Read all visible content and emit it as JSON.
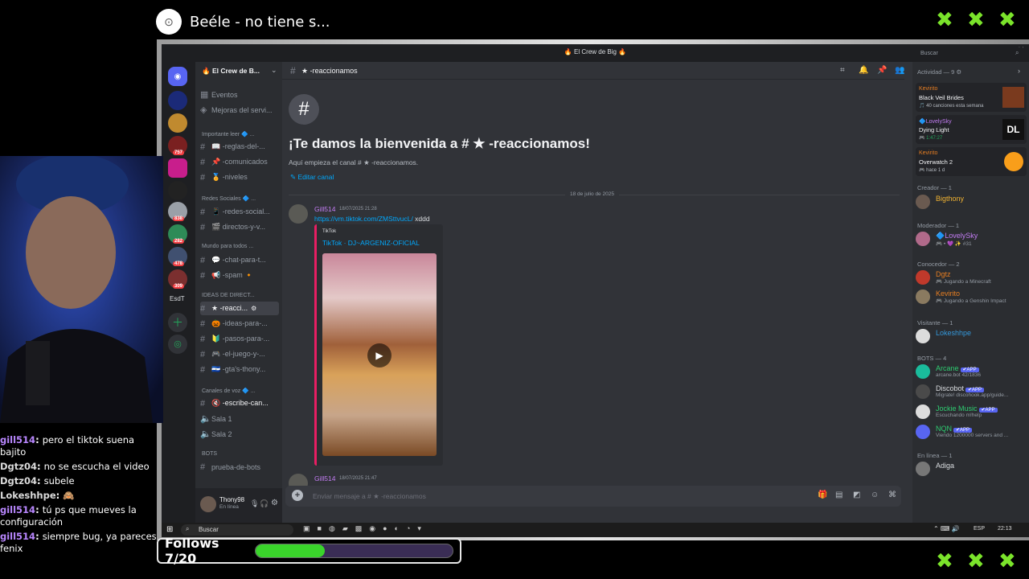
{
  "overlay": {
    "now_playing": "Beéle - no tiene s...",
    "x_marks": [
      "✖",
      "✖",
      "✖"
    ],
    "follows_label": "Follows 7/20",
    "follows_progress": 0.35,
    "accent_color": "#3ad42b"
  },
  "discord": {
    "window_title": "🔥 El Crew de Big 🔥",
    "server_name": "🔥 El Crew de B...",
    "channel_header": "★ -reaccionamos",
    "search_placeholder": "Buscar",
    "top_items": [
      "Eventos",
      "Mejoras del servi..."
    ],
    "categories": {
      "importante": "Importante leer 🔷 ...",
      "redes": "Redes Sociales 🔷 ...",
      "mundo": "Mundo para todos ...",
      "ideas": "IDEAS DE DIRECT...",
      "voz": "Canales de voz 🔷 ...",
      "bots": "BOTS"
    },
    "channels": {
      "reglas": "📖 -reglas-del-...",
      "comunicados": "📌 -comunicados",
      "niveles": "🏅 -niveles",
      "redes_social": "📱 -redes-social...",
      "directos": "🎬 directos-y-v...",
      "chat_para": "💬 -chat-para-t...",
      "spam": "📢 -spam 🔸",
      "reaccionamos": "★ -reacci...",
      "ideas_para": "🎃 -ideas-para-...",
      "pasos_para": "🔰 -pasos-para-...",
      "el_juego": "🎮 -el-juego-y-...",
      "gtas": "🇸🇻 -gta's-thony...",
      "escribe": "🔇 -escribe-can...",
      "sala1": "Sala 1",
      "sala2": "Sala 2",
      "prueba": "prueba-de-bots"
    },
    "server_badges": [
      "757",
      "838",
      "282",
      "478",
      "309"
    ],
    "server_label_esdt": "EsdT",
    "welcome_title": "¡Te damos la bienvenida a # ★ -reaccionamos!",
    "welcome_sub": "Aquí empieza el canal # ★ -reaccionamos.",
    "edit_channel": "Editar canal",
    "date_divider": "18 de julio de 2025",
    "msg1": {
      "author": "Gill514",
      "time": "18/07/2025 21:28",
      "link": "https://vm.tiktok.com/ZMSttvucL/",
      "text": " xddd",
      "embed_provider": "TikTok",
      "embed_title": "TikTok · DJ~ARGENIZ-OFICIAL"
    },
    "msg2": {
      "author": "Gill514",
      "time": "18/07/2025 21:47"
    },
    "composer_placeholder": "Enviar mensaje a # ★ -reaccionamos",
    "user": {
      "name": "Thony98",
      "status": "En línea"
    },
    "members": {
      "activity_header": "Actividad — 9 ⚙",
      "activities": [
        {
          "user": "Kevirito",
          "title": "Black Veil Brides",
          "sub": "🎵 40 canciones esta semana"
        },
        {
          "user": "🔷LovelySky",
          "title": "Dying Light",
          "sub": "🎮 1:47:27"
        },
        {
          "user": "Kevirito",
          "title": "Overwatch 2",
          "sub": "🎮 hace 1 d"
        }
      ],
      "groups": [
        {
          "label": "Creador — 1",
          "members": [
            {
              "name": "Bigthony",
              "sub": "",
              "color": "#f0b232"
            }
          ]
        },
        {
          "label": "Moderador — 1",
          "members": [
            {
              "name": "🔷LovelySky",
              "sub": "🎮 • 💜 ✨ #31",
              "color": "#c27cf2"
            }
          ]
        },
        {
          "label": "Conocedor — 2",
          "members": [
            {
              "name": "Dgtz",
              "sub": "🎮 Jugando a Minecraft",
              "color": "#e67e22"
            },
            {
              "name": "Kevirito",
              "sub": "🎮 Jugando a Genshin Impact",
              "color": "#e67e22"
            }
          ]
        },
        {
          "label": "Visitante — 1",
          "members": [
            {
              "name": "Lokeshhpe",
              "sub": "",
              "color": "#3498db"
            }
          ]
        },
        {
          "label": "BOTS — 4",
          "members": [
            {
              "name": "Arcane",
              "sub": "arcane.bot 42/1836",
              "color": "#2ecc71",
              "app": "✔APP"
            },
            {
              "name": "Discobot",
              "sub": "Migrate! discohook.app/guide...",
              "color": "#dbdee1",
              "app": "✔APP"
            },
            {
              "name": "Jockie Music",
              "sub": "Escuchando m!help",
              "color": "#2ecc71",
              "app": "✔APP"
            },
            {
              "name": "NQN",
              "sub": "Viendo 1200000 servers and ...",
              "color": "#2ecc71",
              "app": "✔APP"
            }
          ]
        },
        {
          "label": "En línea — 1",
          "members": [
            {
              "name": "Adiga",
              "sub": "",
              "color": "#dbdee1"
            }
          ]
        }
      ]
    }
  },
  "taskbar": {
    "search": "Buscar",
    "lang": "ESP",
    "clock": "22:13"
  },
  "twitch_chat": [
    {
      "user": "gill514",
      "color": "#b987ff",
      "text": "pero el tiktok suena bajito"
    },
    {
      "user": "Dgtz04",
      "color": "#dbdbdb",
      "text": "no se escucha el video"
    },
    {
      "user": "Dgtz04",
      "color": "#dbdbdb",
      "text": "subele"
    },
    {
      "user": "Lokeshhpe",
      "color": "#dbdbdb",
      "text": "🙈"
    },
    {
      "user": "gill514",
      "color": "#b987ff",
      "text": "tú ps que mueves la configuración"
    },
    {
      "user": "gill514",
      "color": "#b987ff",
      "text": "siempre bug, ya pareces fenix"
    }
  ]
}
